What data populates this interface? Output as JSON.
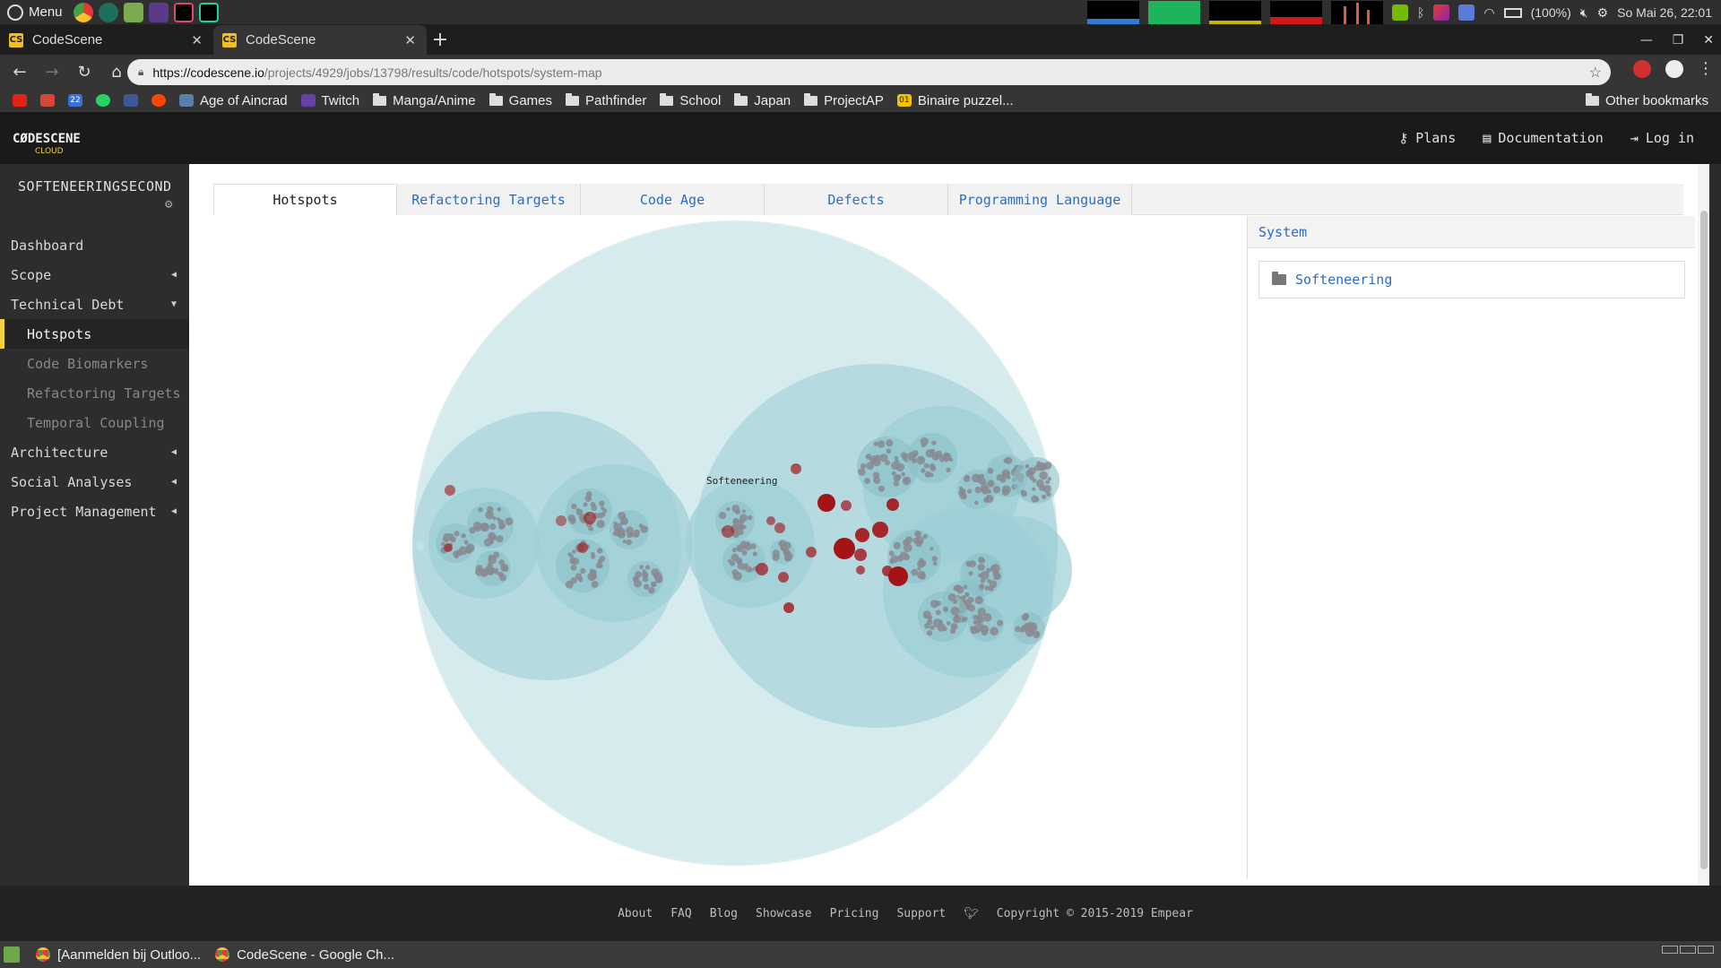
{
  "os_panel": {
    "menu_label": "Menu",
    "battery": "(100%)",
    "datetime": "So Mai 26, 22:01"
  },
  "browser": {
    "tabs": [
      {
        "title": "CodeScene",
        "favicon": "CS"
      },
      {
        "title": "CodeScene",
        "favicon": "CS"
      }
    ],
    "url_host": "https://codescene.io",
    "url_path": "/projects/4929/jobs/13798/results/code/hotspots/system-map",
    "bookmarks": [
      {
        "label": "Age of Aincrad",
        "icon": "aincrad-icon"
      },
      {
        "label": "Twitch",
        "icon": "twitch-icon"
      },
      {
        "label": "Manga/Anime",
        "icon": "folder-icon"
      },
      {
        "label": "Games",
        "icon": "folder-icon"
      },
      {
        "label": "Pathfinder",
        "icon": "folder-icon"
      },
      {
        "label": "School",
        "icon": "folder-icon"
      },
      {
        "label": "Japan",
        "icon": "folder-icon"
      },
      {
        "label": "ProjectAP",
        "icon": "folder-icon"
      },
      {
        "label": "Binaire puzzel...",
        "icon": "bookmark-01-icon"
      }
    ],
    "bookmark_icon_22": "22",
    "bookmark_01": "01",
    "other_bookmarks": "Other bookmarks"
  },
  "app": {
    "logo": "CØDESCENE",
    "logo_sub": "CLOUD",
    "nav": {
      "plans": "Plans",
      "documentation": "Documentation",
      "login": "Log in"
    }
  },
  "sidebar": {
    "project_name": "SOFTENEERINGSECOND",
    "items": [
      {
        "label": "Dashboard"
      },
      {
        "label": "Scope"
      },
      {
        "label": "Technical Debt"
      },
      {
        "label": "Hotspots"
      },
      {
        "label": "Code Biomarkers"
      },
      {
        "label": "Refactoring Targets"
      },
      {
        "label": "Temporal Coupling"
      },
      {
        "label": "Architecture"
      },
      {
        "label": "Social Analyses"
      },
      {
        "label": "Project Management"
      }
    ]
  },
  "main": {
    "tabs": [
      {
        "label": "Hotspots"
      },
      {
        "label": "Refactoring Targets"
      },
      {
        "label": "Code Age"
      },
      {
        "label": "Defects"
      },
      {
        "label": "Programming Language"
      }
    ],
    "viz_label": "Softeneering",
    "panel_title": "System",
    "panel_entry": "Softeneering"
  },
  "colors": {
    "accent_yellow": "#f2d13a",
    "link_blue": "#2a6dc9",
    "circle_outer": "#dcedee",
    "circle_inner": "#a9d5db",
    "hotspot_red": "#a31318"
  },
  "footer": {
    "links": [
      "About",
      "FAQ",
      "Blog",
      "Showcase",
      "Pricing",
      "Support"
    ],
    "copyright": "Copyright © 2015-2019 Empear"
  },
  "taskbar": {
    "tasks": [
      {
        "label": "[Aanmelden bij Outloo..."
      },
      {
        "label": "CodeScene - Google Ch..."
      }
    ]
  }
}
